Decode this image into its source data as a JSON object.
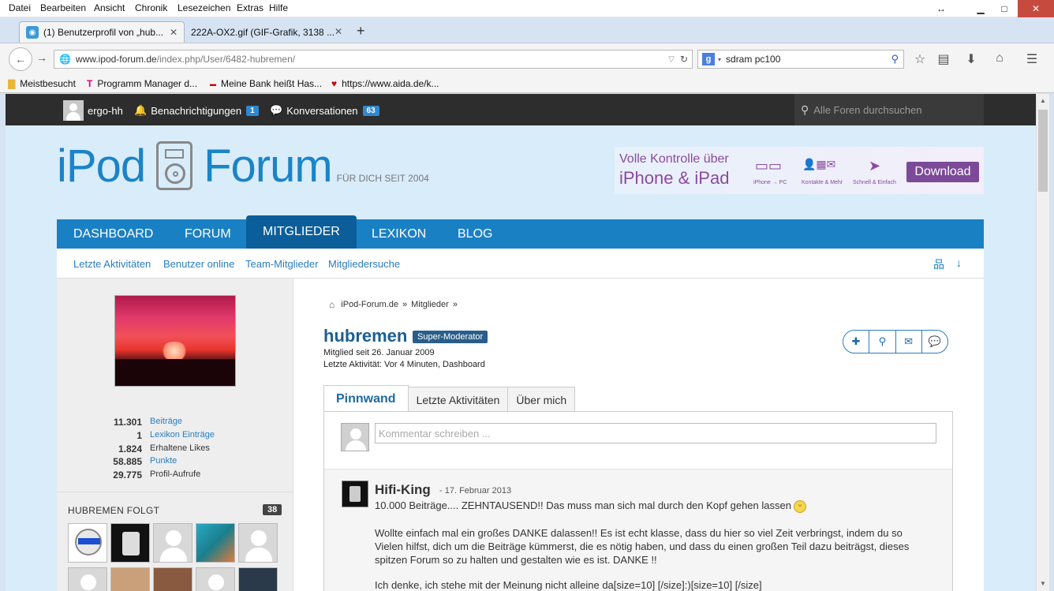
{
  "menubar": {
    "items": [
      "Datei",
      "Bearbeiten",
      "Ansicht",
      "Chronik",
      "Lesezeichen",
      "Extras",
      "Hilfe"
    ]
  },
  "tabs": [
    {
      "title": "(1) Benutzerprofil von „hub...",
      "active": true
    },
    {
      "title": "222A-OX2.gif (GIF-Grafik, 3138 ...",
      "active": false
    }
  ],
  "navbar": {
    "url_host": "www.ipod-forum.de",
    "url_path": "/index.php/User/6482-hubremen/",
    "search_value": "sdram pc100"
  },
  "bookmarks": [
    "Meistbesucht",
    "Programm Manager d...",
    "Meine Bank heißt Has...",
    "https://www.aida.de/k..."
  ],
  "userbar": {
    "username": "ergo-hh",
    "notifications_label": "Benachrichtigungen",
    "notifications_count": "1",
    "conversations_label": "Konversationen",
    "conversations_count": "63",
    "search_placeholder": "Alle Foren durchsuchen"
  },
  "header": {
    "logo_left": "iPod",
    "logo_right": "Forum",
    "tagline": "FÜR DICH SEIT 2004"
  },
  "ad": {
    "line1": "Volle Kontrolle über",
    "line2": "iPhone & iPad",
    "feature1": "iPhone → PC",
    "feature2": "Kontakte & Mehr",
    "feature3": "Schnell & Einfach",
    "download": "Download"
  },
  "mainnav": [
    "DASHBOARD",
    "FORUM",
    "MITGLIEDER",
    "LEXIKON",
    "BLOG"
  ],
  "subnav": [
    "Letzte Aktivitäten",
    "Benutzer online",
    "Team-Mitglieder",
    "Mitgliedersuche"
  ],
  "stats": [
    {
      "value": "11.301",
      "label": "Beiträge"
    },
    {
      "value": "1",
      "label": "Lexikon Einträge"
    },
    {
      "value": "1.824",
      "label": "Erhaltene Likes"
    },
    {
      "value": "58.885",
      "label": "Punkte"
    },
    {
      "value": "29.775",
      "label": "Profil-Aufrufe"
    }
  ],
  "following": {
    "title": "HUBREMEN FOLGT",
    "count": "38"
  },
  "breadcrumb": [
    "iPod-Forum.de",
    "»",
    "Mitglieder",
    "»"
  ],
  "profile": {
    "name": "hubremen",
    "rank": "Super-Moderator",
    "member_since": "Mitglied seit 26. Januar 2009",
    "last_activity": "Letzte Aktivität: Vor 4 Minuten, Dashboard"
  },
  "profile_tabs": [
    "Pinnwand",
    "Letzte Aktivitäten",
    "Über mich"
  ],
  "wall": {
    "comment_placeholder": "Kommentar schreiben ...",
    "post": {
      "author": "Hifi-King",
      "date": "- 17. Februar 2013",
      "line1": "10.000 Beiträge.... ZEHNTAUSEND!! Das muss man sich mal durch den Kopf gehen lassen",
      "line2": "Wollte einfach mal ein großes DANKE dalassen!! Es ist echt klasse, dass du hier so viel Zeit verbringst, indem du so",
      "line3": "Vielen hilfst, dich um die Beiträge kümmerst, die es nötig haben, und dass du einen großen Teil dazu beiträgst, dieses",
      "line4": "spitzen Forum so zu halten und gestalten wie es ist. DANKE !!",
      "line5": "Ich denke, ich stehe mit der Meinung nicht alleine da[size=10] [/size]:)[size=10] [/size]"
    }
  }
}
